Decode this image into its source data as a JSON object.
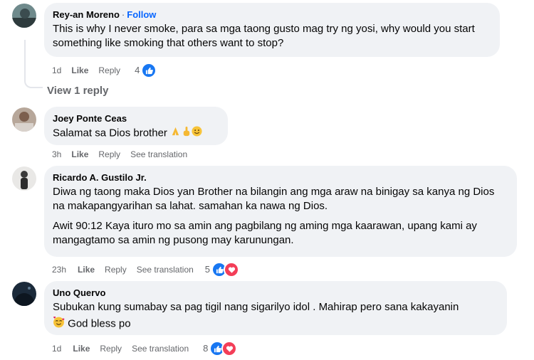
{
  "comments": [
    {
      "author": "Rey-an Moreno",
      "follow": "Follow",
      "text": "This is why I never smoke, para sa mga taong gusto mag try ng yosi, why would you start something like smoking that others want to stop?",
      "time": "1d",
      "like": "Like",
      "reply": "Reply",
      "reaction_count": "4",
      "reactions": [
        "like-icon"
      ],
      "view_replies": "View 1 reply"
    },
    {
      "author": "Joey Ponte Ceas",
      "text": "Salamat sa Dios brother",
      "emojis": [
        "praying-hands-emoji",
        "pointing-hand-emoji",
        "smiling-face-emoji"
      ],
      "time": "3h",
      "like": "Like",
      "reply": "Reply",
      "see_translation": "See translation"
    },
    {
      "author": "Ricardo A. Gustilo Jr.",
      "text": "Diwa ng taong maka Dios yan Brother na bilangin ang mga araw na binigay sa kanya ng Dios na makapangyarihan sa lahat. samahan ka nawa ng Dios.",
      "text2": "Awit 90:12 Kaya ituro mo sa amin ang pagbilang ng aming mga kaarawan, upang kami ay mangagtamo sa amin ng pusong may karunungan.",
      "time": "23h",
      "like": "Like",
      "reply": "Reply",
      "see_translation": "See translation",
      "reaction_count": "5",
      "reactions": [
        "like-icon",
        "love-icon"
      ]
    },
    {
      "author": "Uno Quervo",
      "text": "Subukan kung sumabay sa pag tigil nang sigarilyo idol . Mahirap pero sana kakayanin",
      "text2": "God bless po",
      "emojis": [
        "smiling-face-with-hearts-emoji"
      ],
      "time": "1d",
      "like": "Like",
      "reply": "Reply",
      "see_translation": "See translation",
      "reaction_count": "8",
      "reactions": [
        "like-icon",
        "love-icon"
      ]
    }
  ],
  "colors": {
    "bubble": "#f0f2f5",
    "meta_text": "#65676b",
    "follow_blue": "#0866ff",
    "like_blue": "#1877f2",
    "love_red": "#f33e58"
  }
}
